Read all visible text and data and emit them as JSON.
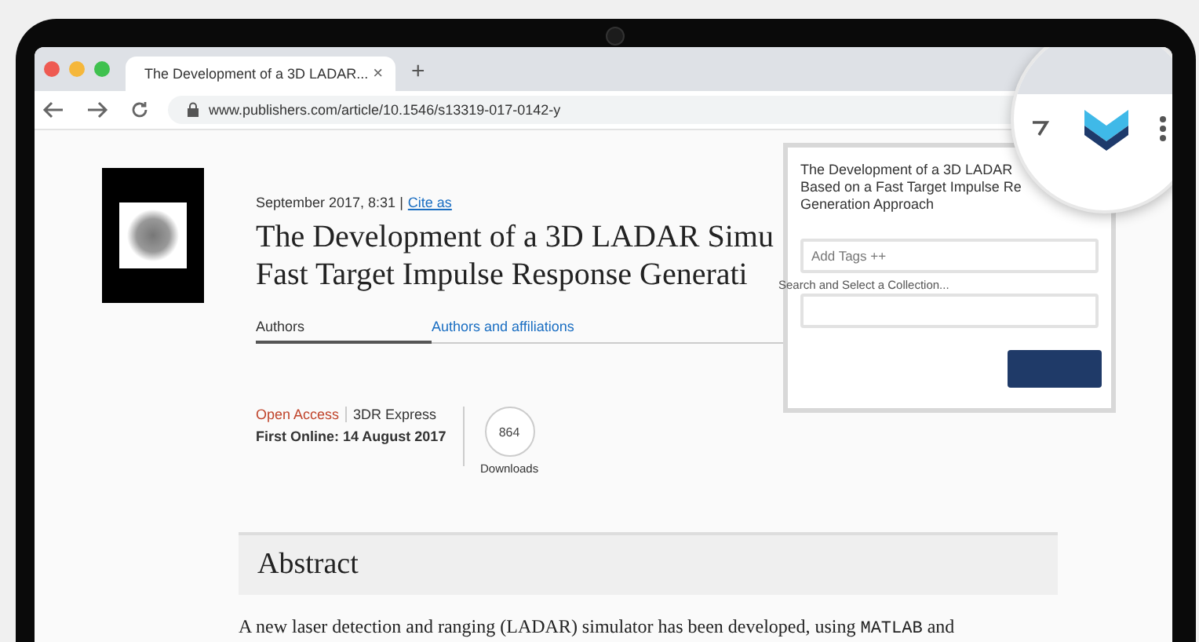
{
  "browser": {
    "tab": {
      "title": "The Development of a 3D LADAR...",
      "close": "×"
    },
    "new_tab": "+",
    "url": "www.publishers.com/article/10.1546/s13319-017-0142-y"
  },
  "article": {
    "date": "September 2017, 8:31",
    "separator": "|",
    "cite_link": "Cite as",
    "title_lines": [
      "The Development of a 3D LADAR Simu",
      "Fast Target Impulse Response Generati"
    ],
    "tabs": [
      {
        "label": "Authors",
        "selected": true
      },
      {
        "label": "Authors and affiliations",
        "selected": false
      }
    ],
    "access": "Open Access",
    "journal": "3DR Express",
    "first_online": "First Online: 14 August 2017",
    "downloads_count": "864",
    "downloads_label": "Downloads",
    "abstract_heading": "Abstract",
    "abstract_parts": [
      {
        "kind": "text",
        "text": "A new laser detection and ranging (LADAR) simulator has been developed, using "
      },
      {
        "kind": "code",
        "text": "MATLAB"
      },
      {
        "kind": "text",
        "text": " and"
      }
    ]
  },
  "popup": {
    "title_lines": [
      "The Development of a 3D LADAR",
      "Based on a Fast Target Impulse Re",
      "Generation Approach"
    ],
    "tags_placeholder": "Add Tags ++",
    "collection_label": "Search and Select a Collection..."
  }
}
